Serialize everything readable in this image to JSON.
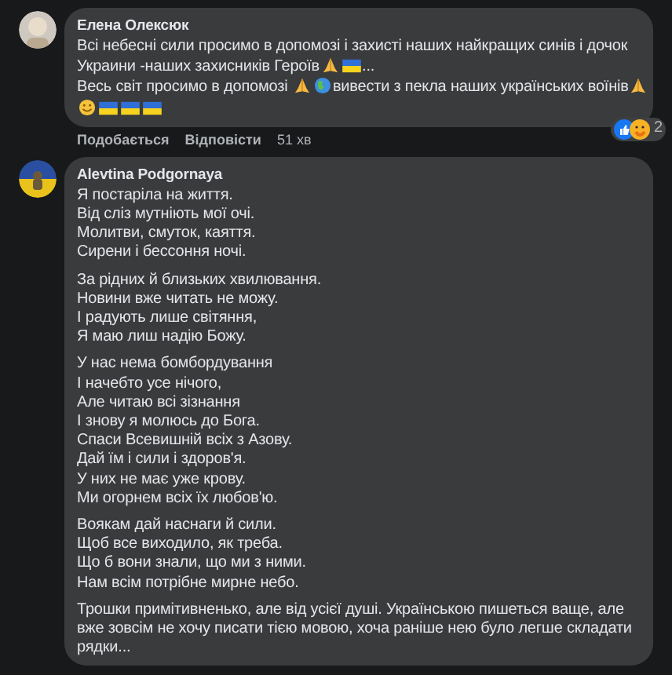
{
  "comments": [
    {
      "author": "Елена Олексюк",
      "avatar": {
        "kind": "picture"
      },
      "lines": [
        [
          {
            "kind": "text",
            "text": "Всі небесні сили просимо в допомозі і захисті наших найкращих синів і дочок"
          }
        ],
        [
          {
            "kind": "text",
            "text": "Украини -наших захисників Героїв"
          },
          {
            "kind": "pray"
          },
          {
            "kind": "flag"
          },
          {
            "kind": "text",
            "text": "..."
          }
        ],
        [
          {
            "kind": "text",
            "text": "Весь світ просимо в допомозі "
          },
          {
            "kind": "pray"
          },
          {
            "kind": "globe"
          },
          {
            "kind": "text",
            "text": "вивести з пекла наших українських воїнів"
          },
          {
            "kind": "pray"
          }
        ],
        [
          {
            "kind": "smile"
          },
          {
            "kind": "flag"
          },
          {
            "kind": "flag"
          },
          {
            "kind": "flag"
          }
        ]
      ],
      "actions": [
        "Подобається",
        "Відповісти"
      ],
      "time": "51 хв",
      "reaction_count": "2"
    },
    {
      "author": "Alevtina Podgornaya",
      "avatar": {
        "kind": "picture"
      },
      "paragraphs": [
        [
          "Я постаріла на життя.",
          "Від сліз мутніють мої очі.",
          "Молитви, смуток, каяття.",
          "Сирени і бессоння ночі."
        ],
        [
          "За рідних й близьких хвилювання.",
          "Новини вже читать не можу.",
          "І радують лише світяння,",
          "Я маю лиш надію Божу."
        ],
        [
          "У нас нема бомбордування",
          "І начебто усе нічого,",
          "Але читаю всі зізнання",
          "І знову я молюсь до Бога.",
          "Спаси Всевишній всіх з Азову.",
          "Дай їм і сили і здоров'я.",
          "У них не має уже крову.",
          "Ми огорнем всіх їх любов'ю."
        ],
        [
          "Воякам дай наснаги й сили.",
          "Щоб все виходило, як треба.",
          "Що б вони знали, що ми з ними.",
          "Нам всім потрібне мирне небо."
        ],
        [
          "Трошки примітивненько, але від усієї душі. Українською пишеться ваще, але вже зовсім не хочу писати тією мовою, хоча раніше нею було легше складати рядки..."
        ]
      ]
    }
  ]
}
